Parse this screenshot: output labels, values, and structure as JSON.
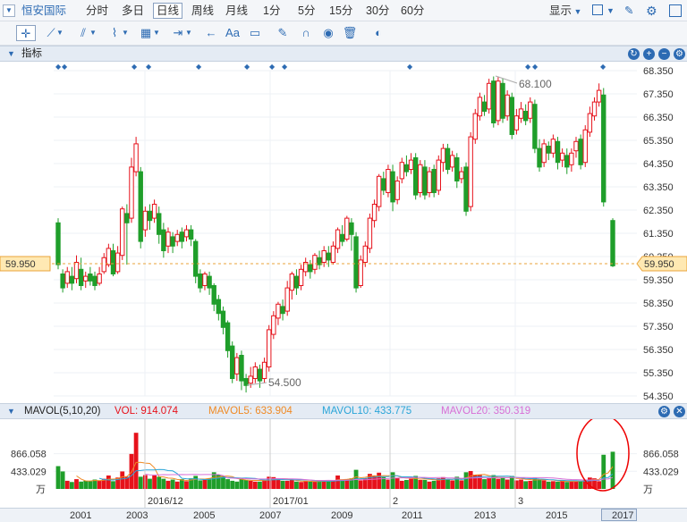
{
  "toolbar": {
    "brand": "恒安国际",
    "periods": [
      "分时",
      "多日",
      "日线",
      "周线",
      "月线",
      "1分",
      "5分",
      "15分",
      "30分",
      "60分"
    ],
    "active_period": "日线",
    "display_label": "显示",
    "icons": [
      "crosshair-icon",
      "line-tool-icon",
      "channel-tool-icon",
      "zigzag-tool-icon",
      "measure-tool-icon",
      "range-tool-icon",
      "back-arrow-icon",
      "text-tool-icon",
      "comment-icon",
      "pen-icon",
      "magnet-icon",
      "eye-icon",
      "trash-icon",
      "toggle-icon"
    ],
    "text_tool_label": "Aa"
  },
  "price_panel": {
    "title": "指标",
    "current_price_label": "59.950",
    "ticks": [
      "68.350",
      "67.350",
      "66.350",
      "65.350",
      "64.350",
      "63.350",
      "62.350",
      "61.350",
      "60.350",
      "59.350",
      "58.350",
      "57.350",
      "56.350",
      "55.350",
      "54.350"
    ],
    "max_annotation": "68.100",
    "min_annotation": "54.500"
  },
  "volume_panel": {
    "title": "MAVOL(5,10,20)",
    "vol": "VOL: 914.074",
    "mavol5": "MAVOL5: 633.904",
    "mavol10": "MAVOL10: 433.775",
    "mavol20": "MAVOL20: 350.319",
    "ticks": [
      "866.058",
      "433.029",
      "万"
    ],
    "date_labels": [
      "2016/12",
      "2017/01",
      "2",
      "3"
    ]
  },
  "timeline": {
    "years": [
      "2001",
      "2003",
      "2005",
      "2007",
      "2009",
      "2011",
      "2013",
      "2015",
      "2017"
    ]
  },
  "colors": {
    "up": "#e6121b",
    "down": "#1f9e2a",
    "price_line": "#e8a33a",
    "mavol5": "#f08a24",
    "mavol10": "#2aa5d8",
    "mavol20": "#d86fd6",
    "accent": "#2d6bb3"
  },
  "chart_data": {
    "type": "candlestick",
    "ylim": [
      54.35,
      68.35
    ],
    "reference_price": 59.95,
    "candles": [
      [
        61.8,
        60.0,
        62.0,
        59.8
      ],
      [
        59.6,
        59.0,
        59.8,
        58.8
      ],
      [
        59.2,
        59.7,
        59.9,
        59.0
      ],
      [
        59.5,
        59.2,
        59.9,
        58.9
      ],
      [
        59.4,
        60.1,
        60.4,
        59.2
      ],
      [
        59.8,
        59.1,
        60.3,
        58.9
      ],
      [
        59.3,
        59.5,
        59.7,
        59.0
      ],
      [
        59.6,
        59.3,
        59.9,
        59.1
      ],
      [
        59.5,
        59.1,
        59.7,
        58.9
      ],
      [
        59.2,
        59.6,
        59.9,
        59.1
      ],
      [
        59.7,
        60.3,
        60.5,
        59.6
      ],
      [
        60.0,
        60.7,
        60.9,
        59.9
      ],
      [
        60.6,
        59.6,
        60.9,
        59.5
      ],
      [
        59.7,
        60.5,
        60.8,
        59.6
      ],
      [
        60.4,
        62.4,
        62.5,
        60.2
      ],
      [
        62.2,
        61.8,
        62.6,
        60.0
      ],
      [
        62.0,
        64.2,
        64.6,
        61.8
      ],
      [
        64.0,
        65.2,
        65.5,
        63.8
      ],
      [
        64.0,
        61.0,
        64.2,
        60.7
      ],
      [
        61.5,
        62.3,
        62.5,
        61.2
      ],
      [
        62.3,
        61.9,
        62.6,
        61.5
      ],
      [
        62.0,
        62.6,
        62.8,
        61.8
      ],
      [
        62.2,
        61.3,
        62.5,
        60.9
      ],
      [
        61.5,
        60.6,
        61.8,
        60.3
      ],
      [
        60.8,
        61.4,
        61.6,
        60.5
      ],
      [
        61.2,
        60.8,
        61.4,
        60.5
      ],
      [
        61.0,
        61.3,
        61.5,
        60.8
      ],
      [
        61.4,
        61.0,
        61.6,
        60.7
      ],
      [
        61.2,
        61.5,
        61.7,
        61.0
      ],
      [
        61.5,
        61.1,
        61.7,
        60.8
      ],
      [
        61.0,
        59.5,
        61.1,
        59.2
      ],
      [
        59.6,
        59.0,
        59.8,
        58.8
      ],
      [
        59.1,
        59.6,
        59.7,
        58.9
      ],
      [
        59.5,
        59.0,
        59.7,
        58.7
      ],
      [
        59.1,
        58.3,
        59.2,
        58.0
      ],
      [
        58.5,
        57.9,
        58.7,
        57.6
      ],
      [
        58.0,
        57.3,
        58.2,
        57.0
      ],
      [
        57.5,
        56.3,
        57.6,
        56.0
      ],
      [
        56.5,
        55.1,
        56.7,
        54.9
      ],
      [
        55.3,
        56.0,
        56.2,
        55.0
      ],
      [
        56.1,
        55.0,
        56.3,
        54.6
      ],
      [
        55.1,
        54.8,
        55.3,
        54.5
      ],
      [
        54.9,
        55.2,
        55.6,
        54.7
      ],
      [
        55.1,
        55.6,
        55.8,
        54.9
      ],
      [
        55.5,
        55.0,
        55.7,
        54.7
      ],
      [
        55.1,
        55.8,
        56.0,
        54.9
      ],
      [
        55.6,
        57.2,
        57.4,
        55.4
      ],
      [
        57.0,
        57.8,
        58.0,
        56.8
      ],
      [
        57.7,
        58.3,
        58.4,
        57.4
      ],
      [
        58.2,
        57.9,
        58.5,
        57.6
      ],
      [
        58.0,
        59.0,
        59.3,
        57.8
      ],
      [
        58.9,
        59.6,
        59.7,
        58.5
      ],
      [
        59.5,
        59.0,
        59.8,
        58.7
      ],
      [
        59.1,
        59.8,
        60.0,
        58.9
      ],
      [
        59.7,
        60.1,
        60.3,
        59.5
      ],
      [
        60.0,
        59.7,
        60.2,
        59.4
      ],
      [
        59.8,
        60.4,
        60.5,
        59.6
      ],
      [
        60.3,
        60.0,
        60.6,
        59.8
      ],
      [
        60.1,
        60.6,
        60.8,
        59.9
      ],
      [
        60.5,
        60.2,
        60.8,
        59.9
      ],
      [
        60.1,
        60.8,
        61.0,
        60.0
      ],
      [
        60.7,
        61.5,
        61.6,
        60.5
      ],
      [
        61.3,
        61.0,
        61.7,
        60.8
      ],
      [
        61.1,
        62.0,
        62.1,
        61.0
      ],
      [
        61.8,
        61.3,
        62.0,
        60.6
      ],
      [
        61.2,
        59.0,
        61.4,
        58.8
      ],
      [
        59.1,
        60.2,
        60.4,
        59.0
      ],
      [
        60.1,
        60.8,
        61.0,
        59.9
      ],
      [
        60.7,
        62.0,
        62.2,
        60.5
      ],
      [
        61.9,
        62.6,
        62.8,
        61.6
      ],
      [
        62.5,
        63.8,
        63.9,
        62.3
      ],
      [
        63.7,
        63.2,
        64.0,
        63.0
      ],
      [
        63.1,
        64.1,
        64.3,
        62.9
      ],
      [
        64.0,
        62.7,
        64.3,
        62.3
      ],
      [
        62.8,
        63.6,
        63.8,
        62.6
      ],
      [
        63.7,
        64.4,
        64.6,
        63.5
      ],
      [
        64.3,
        64.0,
        64.7,
        63.8
      ],
      [
        64.1,
        64.5,
        64.8,
        63.9
      ],
      [
        64.6,
        63.0,
        64.8,
        62.8
      ],
      [
        63.1,
        64.3,
        64.5,
        62.9
      ],
      [
        64.2,
        63.0,
        64.5,
        62.8
      ],
      [
        63.1,
        64.0,
        64.2,
        62.9
      ],
      [
        64.1,
        63.1,
        64.3,
        62.9
      ],
      [
        63.2,
        64.5,
        64.7,
        63.0
      ],
      [
        64.4,
        65.0,
        65.2,
        64.0
      ],
      [
        65.0,
        64.1,
        65.2,
        63.9
      ],
      [
        64.2,
        64.7,
        64.9,
        64.0
      ],
      [
        64.6,
        63.6,
        64.8,
        63.3
      ],
      [
        63.7,
        64.0,
        64.2,
        63.5
      ],
      [
        64.2,
        62.3,
        64.4,
        62.1
      ],
      [
        62.5,
        65.5,
        65.7,
        62.3
      ],
      [
        65.4,
        66.5,
        66.7,
        65.2
      ],
      [
        66.4,
        67.2,
        67.4,
        66.2
      ],
      [
        67.0,
        66.6,
        67.3,
        66.4
      ],
      [
        66.7,
        67.8,
        68.0,
        66.5
      ],
      [
        67.9,
        66.1,
        68.1,
        65.9
      ],
      [
        66.2,
        67.9,
        68.1,
        66.0
      ],
      [
        67.8,
        66.3,
        68.0,
        66.1
      ],
      [
        66.4,
        67.3,
        67.5,
        66.2
      ],
      [
        67.2,
        65.6,
        67.4,
        65.4
      ],
      [
        65.8,
        66.4,
        66.7,
        65.6
      ],
      [
        66.3,
        66.7,
        67.0,
        66.1
      ],
      [
        66.6,
        66.2,
        66.9,
        66.0
      ],
      [
        66.3,
        67.0,
        67.2,
        66.1
      ],
      [
        66.9,
        65.0,
        67.1,
        64.8
      ],
      [
        65.0,
        64.2,
        65.4,
        64.0
      ],
      [
        64.4,
        65.2,
        65.4,
        64.2
      ],
      [
        65.1,
        64.8,
        65.3,
        64.5
      ],
      [
        64.8,
        65.4,
        65.6,
        64.6
      ],
      [
        65.3,
        64.4,
        65.5,
        64.1
      ],
      [
        64.5,
        64.8,
        65.0,
        64.2
      ],
      [
        64.7,
        64.2,
        65.0,
        63.9
      ],
      [
        64.3,
        64.8,
        65.0,
        64.0
      ],
      [
        64.9,
        65.3,
        65.5,
        64.6
      ],
      [
        65.4,
        64.3,
        65.6,
        64.1
      ],
      [
        64.4,
        65.8,
        66.0,
        64.2
      ],
      [
        65.7,
        66.5,
        66.8,
        65.5
      ],
      [
        66.4,
        67.0,
        67.2,
        66.2
      ],
      [
        67.0,
        67.5,
        67.8,
        66.8
      ],
      [
        67.3,
        62.7,
        67.6,
        62.5
      ],
      [
        null,
        null,
        null,
        null
      ],
      [
        61.9,
        59.95,
        62.0,
        59.9
      ]
    ],
    "volumes": [
      [
        560,
        0
      ],
      [
        430,
        0
      ],
      [
        200,
        1
      ],
      [
        170,
        0
      ],
      [
        240,
        1
      ],
      [
        180,
        0
      ],
      [
        200,
        0
      ],
      [
        190,
        0
      ],
      [
        230,
        0
      ],
      [
        210,
        1
      ],
      [
        250,
        1
      ],
      [
        330,
        1
      ],
      [
        190,
        0
      ],
      [
        280,
        1
      ],
      [
        430,
        1
      ],
      [
        300,
        1
      ],
      [
        860,
        1
      ],
      [
        1380,
        1
      ],
      [
        300,
        0
      ],
      [
        340,
        1
      ],
      [
        250,
        0
      ],
      [
        330,
        1
      ],
      [
        300,
        0
      ],
      [
        250,
        0
      ],
      [
        200,
        1
      ],
      [
        230,
        0
      ],
      [
        180,
        1
      ],
      [
        240,
        0
      ],
      [
        190,
        1
      ],
      [
        260,
        0
      ],
      [
        320,
        0
      ],
      [
        210,
        0
      ],
      [
        230,
        1
      ],
      [
        260,
        0
      ],
      [
        410,
        0
      ],
      [
        350,
        0
      ],
      [
        320,
        0
      ],
      [
        240,
        0
      ],
      [
        200,
        0
      ],
      [
        180,
        0
      ],
      [
        260,
        0
      ],
      [
        220,
        0
      ],
      [
        200,
        1
      ],
      [
        180,
        1
      ],
      [
        180,
        0
      ],
      [
        230,
        1
      ],
      [
        300,
        1
      ],
      [
        290,
        1
      ],
      [
        240,
        1
      ],
      [
        200,
        0
      ],
      [
        200,
        1
      ],
      [
        220,
        1
      ],
      [
        180,
        0
      ],
      [
        170,
        1
      ],
      [
        190,
        1
      ],
      [
        180,
        0
      ],
      [
        180,
        1
      ],
      [
        190,
        0
      ],
      [
        200,
        1
      ],
      [
        190,
        0
      ],
      [
        220,
        1
      ],
      [
        330,
        1
      ],
      [
        200,
        0
      ],
      [
        230,
        1
      ],
      [
        260,
        0
      ],
      [
        470,
        0
      ],
      [
        210,
        1
      ],
      [
        260,
        1
      ],
      [
        370,
        1
      ],
      [
        320,
        1
      ],
      [
        400,
        1
      ],
      [
        290,
        0
      ],
      [
        230,
        1
      ],
      [
        410,
        0
      ],
      [
        270,
        1
      ],
      [
        200,
        1
      ],
      [
        220,
        0
      ],
      [
        250,
        1
      ],
      [
        320,
        0
      ],
      [
        220,
        1
      ],
      [
        220,
        0
      ],
      [
        180,
        1
      ],
      [
        200,
        0
      ],
      [
        260,
        1
      ],
      [
        290,
        1
      ],
      [
        230,
        0
      ],
      [
        210,
        1
      ],
      [
        300,
        0
      ],
      [
        210,
        1
      ],
      [
        410,
        0
      ],
      [
        440,
        1
      ],
      [
        350,
        1
      ],
      [
        340,
        1
      ],
      [
        240,
        0
      ],
      [
        270,
        1
      ],
      [
        340,
        0
      ],
      [
        250,
        1
      ],
      [
        290,
        0
      ],
      [
        230,
        1
      ],
      [
        320,
        0
      ],
      [
        210,
        1
      ],
      [
        230,
        1
      ],
      [
        190,
        0
      ],
      [
        200,
        1
      ],
      [
        270,
        0
      ],
      [
        250,
        0
      ],
      [
        210,
        1
      ],
      [
        180,
        0
      ],
      [
        190,
        1
      ],
      [
        180,
        0
      ],
      [
        200,
        1
      ],
      [
        170,
        0
      ],
      [
        190,
        1
      ],
      [
        180,
        1
      ],
      [
        200,
        0
      ],
      [
        230,
        1
      ],
      [
        280,
        1
      ],
      [
        260,
        1
      ],
      [
        190,
        1
      ],
      [
        840,
        0
      ],
      [
        null,
        null
      ],
      [
        914,
        0
      ]
    ]
  }
}
